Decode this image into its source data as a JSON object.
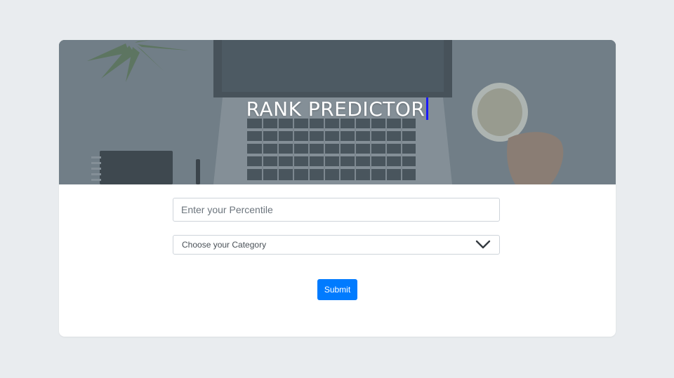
{
  "header": {
    "title": "RANK PREDICTOR"
  },
  "form": {
    "percentile_placeholder": "Enter your Percentile",
    "percentile_value": "",
    "category_selected": "Choose your Category",
    "submit_label": "Submit"
  },
  "icons": {
    "select_arrow": "chevron-down-icon"
  },
  "colors": {
    "page_background": "#e9ecef",
    "card_background": "#ffffff",
    "hero_overlay": "#5d6a74",
    "button_primary": "#007bff",
    "title_text": "#ffffff",
    "cursor_caret": "#1a1aff"
  }
}
